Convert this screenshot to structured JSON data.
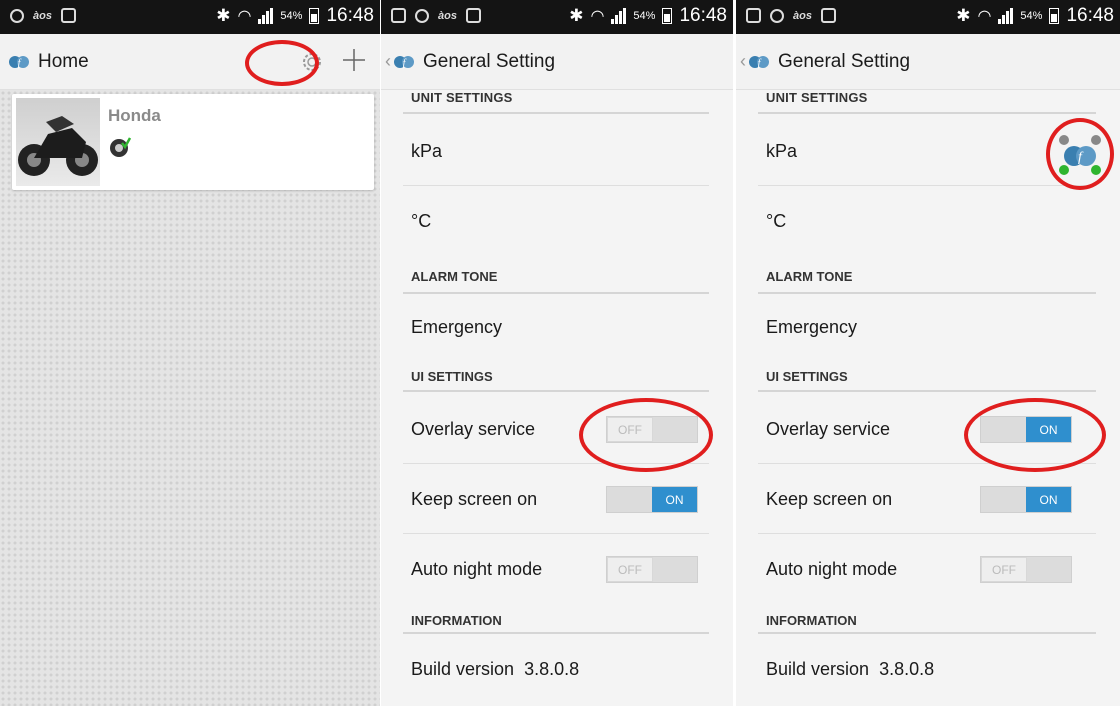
{
  "statusbar": {
    "battery": "54%",
    "time": "16:48",
    "notif_text": "àos"
  },
  "screen1": {
    "title": "Home",
    "vehicle": {
      "name": "Honda"
    }
  },
  "screen2": {
    "title": "General Setting",
    "sections": {
      "unit": "UNIT SETTINGS",
      "alarm": "ALARM TONE",
      "ui": "UI SETTINGS",
      "info": "INFORMATION"
    },
    "rows": {
      "pressure": "kPa",
      "temperature": "°C",
      "tone": "Emergency",
      "overlay": "Overlay service",
      "keep_screen": "Keep screen on",
      "night": "Auto night mode",
      "build_label": "Build version",
      "build_value": "3.8.0.8"
    },
    "toggles": {
      "overlay": "OFF",
      "keep_screen": "ON",
      "night": "OFF"
    }
  },
  "screen3": {
    "title": "General Setting",
    "sections": {
      "unit": "UNIT SETTINGS",
      "alarm": "ALARM TONE",
      "ui": "UI SETTINGS",
      "info": "INFORMATION"
    },
    "rows": {
      "pressure": "kPa",
      "temperature": "°C",
      "tone": "Emergency",
      "overlay": "Overlay service",
      "keep_screen": "Keep screen on",
      "night": "Auto night mode",
      "build_label": "Build version",
      "build_value": "3.8.0.8"
    },
    "toggles": {
      "overlay": "ON",
      "keep_screen": "ON",
      "night": "OFF"
    }
  },
  "colors": {
    "toggle_on": "#2f8fce",
    "annotation": "#e01e1e"
  }
}
